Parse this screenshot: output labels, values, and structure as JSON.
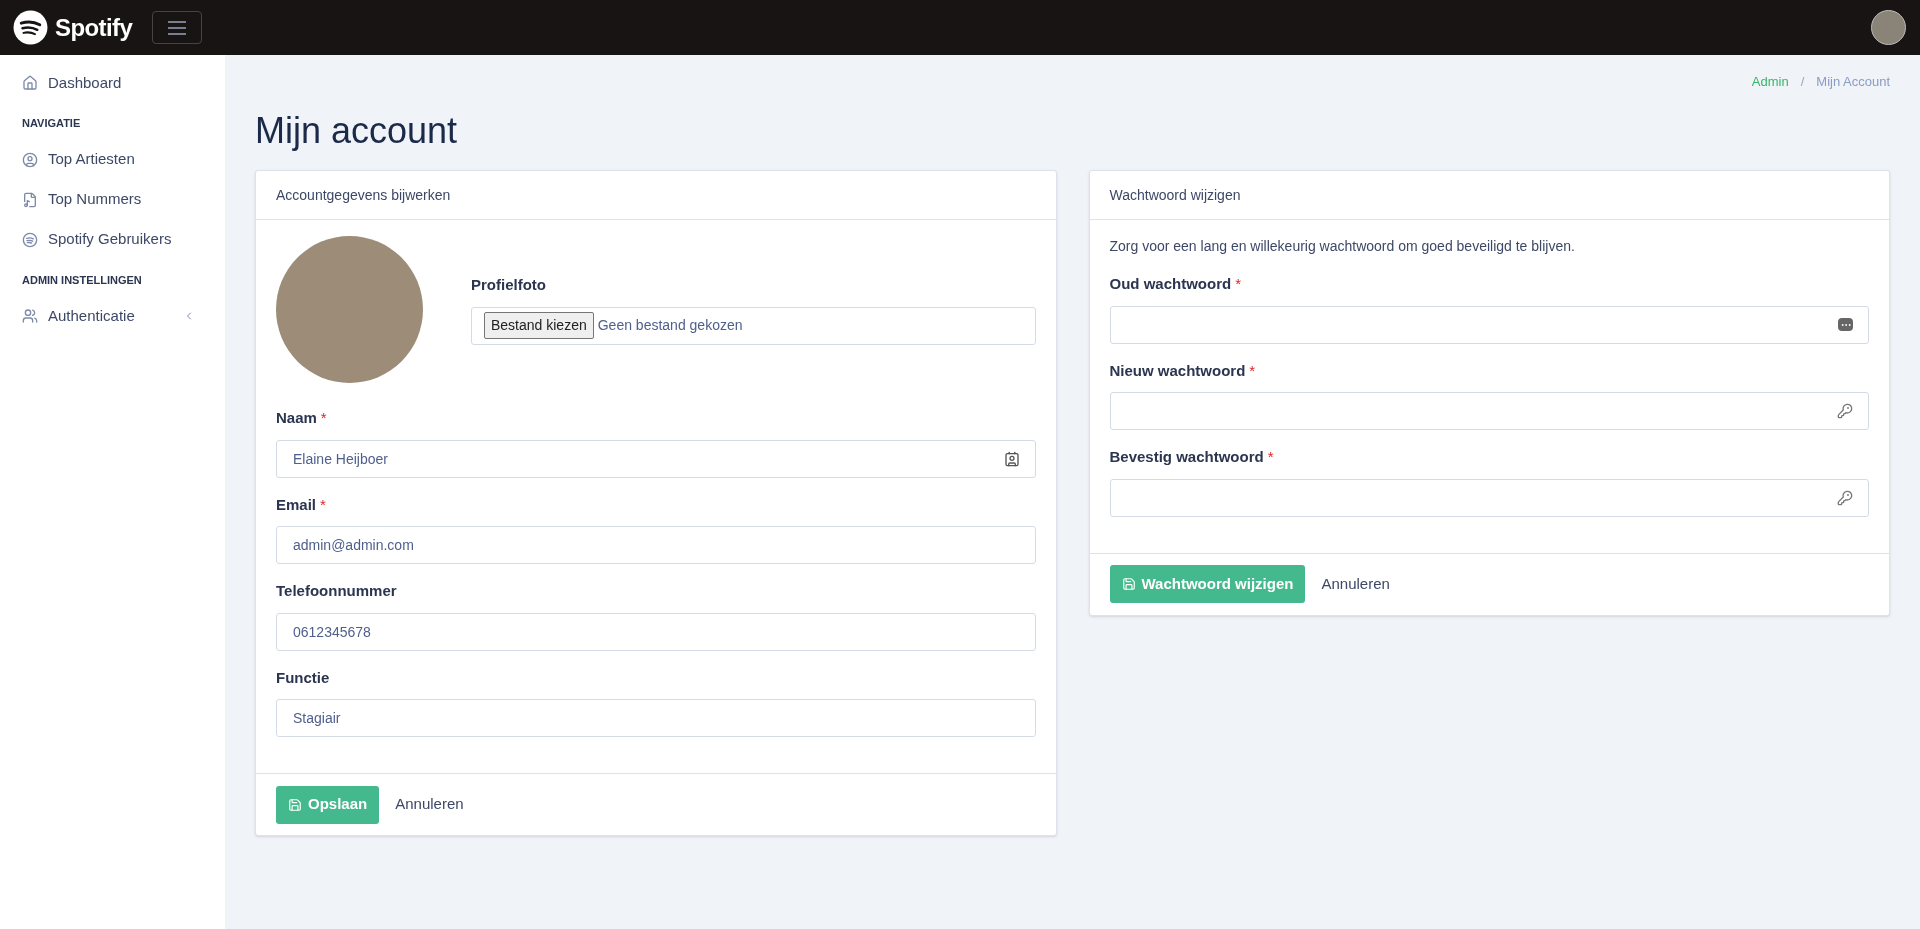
{
  "header": {
    "logo_text": "Spotify"
  },
  "sidebar": {
    "items": [
      {
        "kind": "link",
        "label": "Dashboard"
      },
      {
        "kind": "heading",
        "label": "NAVIGATIE"
      },
      {
        "kind": "link",
        "label": "Top Artiesten"
      },
      {
        "kind": "link",
        "label": "Top Nummers"
      },
      {
        "kind": "link",
        "label": "Spotify Gebruikers"
      },
      {
        "kind": "heading",
        "label": "ADMIN INSTELLINGEN"
      },
      {
        "kind": "group",
        "label": "Authenticatie",
        "expanded": false
      }
    ]
  },
  "breadcrumb": [
    {
      "label": "Admin",
      "selected": false
    },
    {
      "separator": "/",
      "label": "Mijn Account",
      "selected": true
    }
  ],
  "page_title": "Mijn account",
  "account_card": {
    "title": "Accountgegevens bijwerken",
    "photo": {
      "label": "Profielfoto",
      "button": "Bestand kiezen",
      "status": "Geen bestand gekozen"
    },
    "fields": [
      {
        "label": "Naam",
        "required_mark": "*",
        "value": "Elaine Heijboer",
        "kind": "name"
      },
      {
        "label": "Email",
        "required_mark": "*",
        "value": "admin@admin.com",
        "kind": "text"
      },
      {
        "label": "Telefoonnummer",
        "value": "0612345678",
        "kind": "text"
      },
      {
        "label": "Functie",
        "value": "Stagiair",
        "kind": "text"
      }
    ],
    "buttons": [
      "Opslaan",
      "Annuleren"
    ]
  },
  "password_card": {
    "title": "Wachtwoord wijzigen",
    "intro": "Zorg voor een lang en willekeurig wachtwoord om goed beveiligd te blijven.",
    "fields": [
      {
        "label": "Oud wachtwoord",
        "required_mark": "*",
        "kind": "current-password"
      },
      {
        "label": "Nieuw wachtwoord",
        "required_mark": "*",
        "kind": "new-password"
      },
      {
        "label": "Bevestig wachtwoord",
        "required_mark": "*",
        "kind": "new-password"
      }
    ],
    "buttons": [
      "Wachtwoord wijzigen",
      "Annuleren"
    ]
  }
}
